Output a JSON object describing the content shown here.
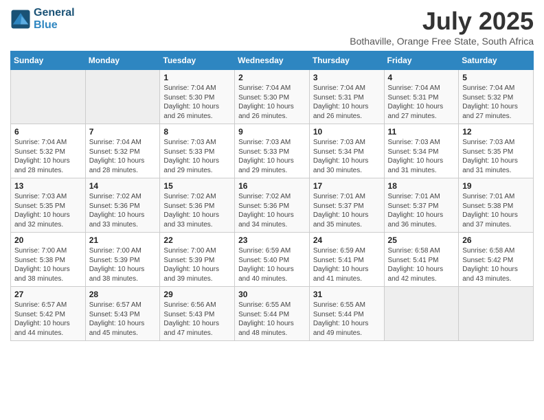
{
  "header": {
    "logo_line1": "General",
    "logo_line2": "Blue",
    "title": "July 2025",
    "subtitle": "Bothaville, Orange Free State, South Africa"
  },
  "days_of_week": [
    "Sunday",
    "Monday",
    "Tuesday",
    "Wednesday",
    "Thursday",
    "Friday",
    "Saturday"
  ],
  "weeks": [
    [
      {
        "day": "",
        "info": ""
      },
      {
        "day": "",
        "info": ""
      },
      {
        "day": "1",
        "info": "Sunrise: 7:04 AM\nSunset: 5:30 PM\nDaylight: 10 hours\nand 26 minutes."
      },
      {
        "day": "2",
        "info": "Sunrise: 7:04 AM\nSunset: 5:30 PM\nDaylight: 10 hours\nand 26 minutes."
      },
      {
        "day": "3",
        "info": "Sunrise: 7:04 AM\nSunset: 5:31 PM\nDaylight: 10 hours\nand 26 minutes."
      },
      {
        "day": "4",
        "info": "Sunrise: 7:04 AM\nSunset: 5:31 PM\nDaylight: 10 hours\nand 27 minutes."
      },
      {
        "day": "5",
        "info": "Sunrise: 7:04 AM\nSunset: 5:32 PM\nDaylight: 10 hours\nand 27 minutes."
      }
    ],
    [
      {
        "day": "6",
        "info": "Sunrise: 7:04 AM\nSunset: 5:32 PM\nDaylight: 10 hours\nand 28 minutes."
      },
      {
        "day": "7",
        "info": "Sunrise: 7:04 AM\nSunset: 5:32 PM\nDaylight: 10 hours\nand 28 minutes."
      },
      {
        "day": "8",
        "info": "Sunrise: 7:03 AM\nSunset: 5:33 PM\nDaylight: 10 hours\nand 29 minutes."
      },
      {
        "day": "9",
        "info": "Sunrise: 7:03 AM\nSunset: 5:33 PM\nDaylight: 10 hours\nand 29 minutes."
      },
      {
        "day": "10",
        "info": "Sunrise: 7:03 AM\nSunset: 5:34 PM\nDaylight: 10 hours\nand 30 minutes."
      },
      {
        "day": "11",
        "info": "Sunrise: 7:03 AM\nSunset: 5:34 PM\nDaylight: 10 hours\nand 31 minutes."
      },
      {
        "day": "12",
        "info": "Sunrise: 7:03 AM\nSunset: 5:35 PM\nDaylight: 10 hours\nand 31 minutes."
      }
    ],
    [
      {
        "day": "13",
        "info": "Sunrise: 7:03 AM\nSunset: 5:35 PM\nDaylight: 10 hours\nand 32 minutes."
      },
      {
        "day": "14",
        "info": "Sunrise: 7:02 AM\nSunset: 5:36 PM\nDaylight: 10 hours\nand 33 minutes."
      },
      {
        "day": "15",
        "info": "Sunrise: 7:02 AM\nSunset: 5:36 PM\nDaylight: 10 hours\nand 33 minutes."
      },
      {
        "day": "16",
        "info": "Sunrise: 7:02 AM\nSunset: 5:36 PM\nDaylight: 10 hours\nand 34 minutes."
      },
      {
        "day": "17",
        "info": "Sunrise: 7:01 AM\nSunset: 5:37 PM\nDaylight: 10 hours\nand 35 minutes."
      },
      {
        "day": "18",
        "info": "Sunrise: 7:01 AM\nSunset: 5:37 PM\nDaylight: 10 hours\nand 36 minutes."
      },
      {
        "day": "19",
        "info": "Sunrise: 7:01 AM\nSunset: 5:38 PM\nDaylight: 10 hours\nand 37 minutes."
      }
    ],
    [
      {
        "day": "20",
        "info": "Sunrise: 7:00 AM\nSunset: 5:38 PM\nDaylight: 10 hours\nand 38 minutes."
      },
      {
        "day": "21",
        "info": "Sunrise: 7:00 AM\nSunset: 5:39 PM\nDaylight: 10 hours\nand 38 minutes."
      },
      {
        "day": "22",
        "info": "Sunrise: 7:00 AM\nSunset: 5:39 PM\nDaylight: 10 hours\nand 39 minutes."
      },
      {
        "day": "23",
        "info": "Sunrise: 6:59 AM\nSunset: 5:40 PM\nDaylight: 10 hours\nand 40 minutes."
      },
      {
        "day": "24",
        "info": "Sunrise: 6:59 AM\nSunset: 5:41 PM\nDaylight: 10 hours\nand 41 minutes."
      },
      {
        "day": "25",
        "info": "Sunrise: 6:58 AM\nSunset: 5:41 PM\nDaylight: 10 hours\nand 42 minutes."
      },
      {
        "day": "26",
        "info": "Sunrise: 6:58 AM\nSunset: 5:42 PM\nDaylight: 10 hours\nand 43 minutes."
      }
    ],
    [
      {
        "day": "27",
        "info": "Sunrise: 6:57 AM\nSunset: 5:42 PM\nDaylight: 10 hours\nand 44 minutes."
      },
      {
        "day": "28",
        "info": "Sunrise: 6:57 AM\nSunset: 5:43 PM\nDaylight: 10 hours\nand 45 minutes."
      },
      {
        "day": "29",
        "info": "Sunrise: 6:56 AM\nSunset: 5:43 PM\nDaylight: 10 hours\nand 47 minutes."
      },
      {
        "day": "30",
        "info": "Sunrise: 6:55 AM\nSunset: 5:44 PM\nDaylight: 10 hours\nand 48 minutes."
      },
      {
        "day": "31",
        "info": "Sunrise: 6:55 AM\nSunset: 5:44 PM\nDaylight: 10 hours\nand 49 minutes."
      },
      {
        "day": "",
        "info": ""
      },
      {
        "day": "",
        "info": ""
      }
    ]
  ]
}
